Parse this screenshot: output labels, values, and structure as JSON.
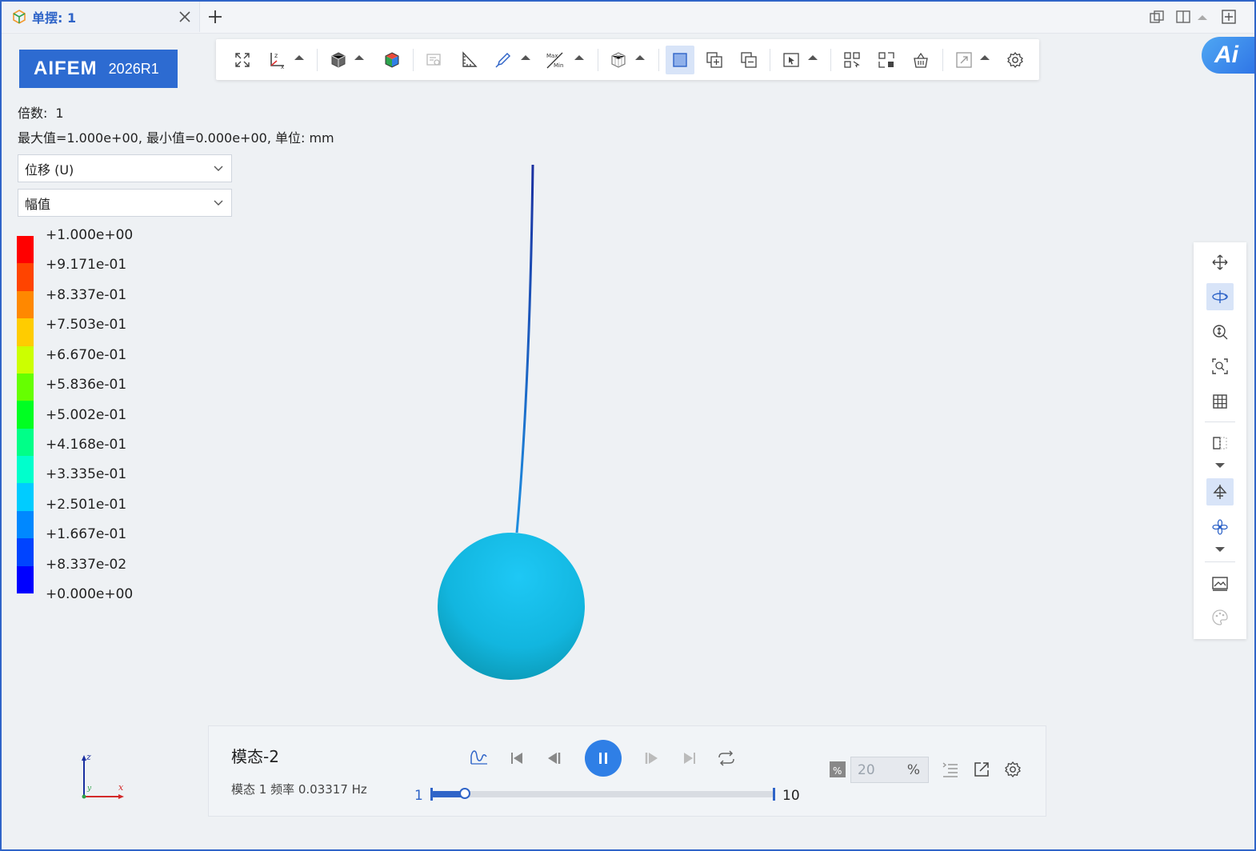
{
  "tab": {
    "title": "单摆: 1"
  },
  "brand": {
    "name": "AIFEM",
    "version": "2026R1"
  },
  "ai_badge": {
    "label": "Ai"
  },
  "info": {
    "scale_label": "倍数:",
    "scale_value": "1",
    "range_text": "最大值=1.000e+00, 最小值=0.000e+00, 单位: mm"
  },
  "selects": {
    "variable": "位移 (U)",
    "component": "幅值"
  },
  "legend": {
    "labels": [
      "+1.000e+00",
      "+9.171e-01",
      "+8.337e-01",
      "+7.503e-01",
      "+6.670e-01",
      "+5.836e-01",
      "+5.002e-01",
      "+4.168e-01",
      "+3.335e-01",
      "+2.501e-01",
      "+1.667e-01",
      "+8.337e-02",
      "+0.000e+00"
    ],
    "colors": [
      "#ff0000",
      "#ff4400",
      "#ff8800",
      "#ffcc00",
      "#ccff00",
      "#66ff00",
      "#00ff22",
      "#00ff88",
      "#00ffcc",
      "#00ccff",
      "#0088ff",
      "#0044ff",
      "#0000ff"
    ]
  },
  "triad": {
    "x": "x",
    "y": "y",
    "z": "z"
  },
  "animation": {
    "mode_title": "模态-2",
    "mode_subtitle": "模态 1 频率 0.03317 Hz",
    "frame_min": "1",
    "frame_max": "10",
    "progress": 0.1,
    "speed_value": "20",
    "speed_unit": "%"
  },
  "colors": {
    "accent": "#2f64c8",
    "brand": "#2d6bd1",
    "sphere": "#12b6df",
    "rod_top": "#1a2fa0",
    "rod_bottom": "#1e8fe0"
  }
}
